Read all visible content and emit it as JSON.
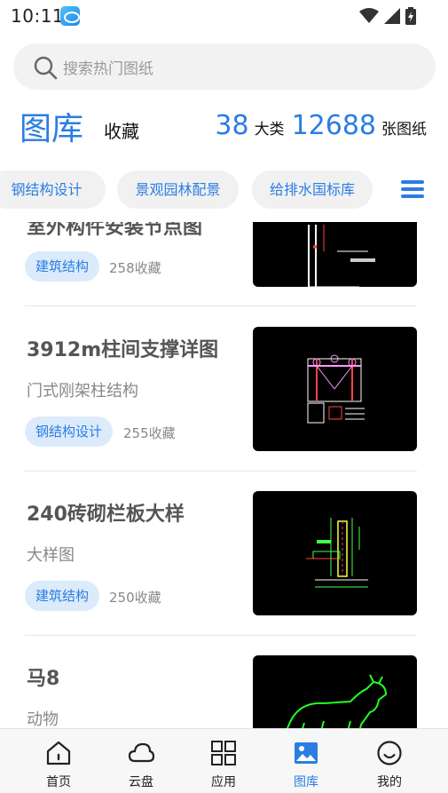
{
  "status_bar": {
    "time": "10:11"
  },
  "search": {
    "placeholder": "搜索热门图纸"
  },
  "header": {
    "title": "图库",
    "favorites_tab": "收藏",
    "category_count": "38",
    "category_unit": "大类",
    "drawing_count": "12688",
    "drawing_unit": "张图纸"
  },
  "categories": [
    "钢结构设计",
    "景观园林配景",
    "给排水国标库"
  ],
  "items": [
    {
      "title": "室外构件安装节点图",
      "subtitle": "",
      "tag": "建筑结构",
      "favorites": "258收藏"
    },
    {
      "title": "3912m柱间支撑详图",
      "subtitle": "门式刚架柱结构",
      "tag": "钢结构设计",
      "favorites": "255收藏"
    },
    {
      "title": "240砖砌栏板大样",
      "subtitle": "大样图",
      "tag": "建筑结构",
      "favorites": "250收藏"
    },
    {
      "title": "马8",
      "subtitle": "动物",
      "tag": "",
      "favorites": ""
    }
  ],
  "bottom_nav": [
    {
      "label": "首页",
      "icon": "home-icon"
    },
    {
      "label": "云盘",
      "icon": "cloud-icon"
    },
    {
      "label": "应用",
      "icon": "apps-grid-icon"
    },
    {
      "label": "图库",
      "icon": "image-gallery-icon",
      "active": true
    },
    {
      "label": "我的",
      "icon": "profile-smile-icon"
    }
  ],
  "colors": {
    "accent": "#2b7de1",
    "tag_bg": "#dcebfb",
    "chip_bg": "#f1f1f1"
  }
}
